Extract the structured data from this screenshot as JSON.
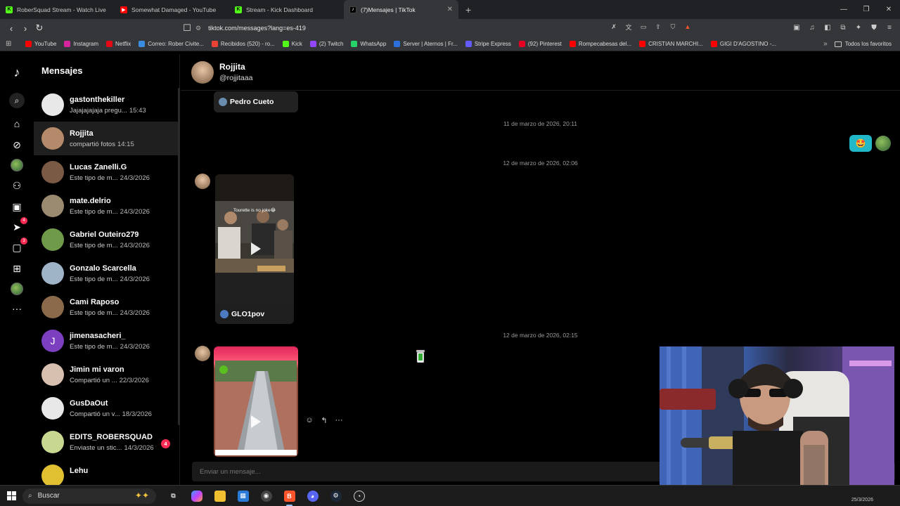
{
  "browser": {
    "tabs": [
      {
        "title": "RoberSquad Stream - Watch Live",
        "icon": "kick-icon"
      },
      {
        "title": "Somewhat Damaged - YouTube",
        "icon": "youtube-icon"
      },
      {
        "title": "Stream - Kick Dashboard",
        "icon": "kick-icon"
      },
      {
        "title": "(7)Mensajes | TikTok",
        "icon": "tiktok-icon"
      }
    ],
    "url": "tiktok.com/messages?lang=es-419",
    "bookmarks": [
      {
        "label": "YouTube",
        "color": "#ff0000"
      },
      {
        "label": "Instagram",
        "color": "#d6249f"
      },
      {
        "label": "Netflix",
        "color": "#e50914"
      },
      {
        "label": "Correo: Rober Civite...",
        "color": "#3a8de0"
      },
      {
        "label": "Recibidos (520) - ro...",
        "color": "#ea4335"
      },
      {
        "label": "Kick",
        "color": "#53fc18"
      },
      {
        "label": "(2) Twitch",
        "color": "#9146ff"
      },
      {
        "label": "WhatsApp",
        "color": "#25d366"
      },
      {
        "label": "Server | Aternos | Fr...",
        "color": "#2a6fdb"
      },
      {
        "label": "Stripe Express",
        "color": "#635bff"
      },
      {
        "label": "(92) Pinterest",
        "color": "#e60023"
      },
      {
        "label": "Rompecabesas del...",
        "color": "#ff0000"
      },
      {
        "label": "CRISTIAN MARCHI...",
        "color": "#ff0000"
      },
      {
        "label": "GIGI D'AGOSTINO -...",
        "color": "#ff0000"
      }
    ],
    "all_bookmarks": "Todos los favoritos"
  },
  "sidebar": {
    "title": "Mensajes",
    "conversations": [
      {
        "name": "gastonthekiller",
        "preview": "Jajajajajaja pregu...",
        "time": "15:43",
        "avatar_color": "#e8e8e8"
      },
      {
        "name": "Rojjita",
        "preview": "compartió fotos",
        "time": "14:15",
        "avatar_color": "#b48a6a"
      },
      {
        "name": "Lucas Zanelli.G",
        "preview": "Este tipo de m...",
        "time": "24/3/2026",
        "avatar_color": "#7a5a44"
      },
      {
        "name": "mate.delrio",
        "preview": "Este tipo de m...",
        "time": "24/3/2026",
        "avatar_color": "#9a8a70"
      },
      {
        "name": "Gabriel Outeiro279",
        "preview": "Este tipo de m...",
        "time": "24/3/2026",
        "avatar_color": "#6f9a4a"
      },
      {
        "name": "Gonzalo Scarcella",
        "preview": "Este tipo de m...",
        "time": "24/3/2026",
        "avatar_color": "#a0b4c8"
      },
      {
        "name": "Cami Raposo",
        "preview": "Este tipo de m...",
        "time": "24/3/2026",
        "avatar_color": "#8a6a4a"
      },
      {
        "name": "jimenasacheri_",
        "preview": "Este tipo de m...",
        "time": "24/3/2026",
        "avatar_color": "#7b3fc0",
        "initial": "J"
      },
      {
        "name": "Jimin mi varon",
        "preview": "Compartió un ...",
        "time": "22/3/2026",
        "avatar_color": "#d8c0b0"
      },
      {
        "name": "GusDaOut",
        "preview": "Compartió un v...",
        "time": "18/3/2026",
        "avatar_color": "#e8e8e8"
      },
      {
        "name": "EDITS_ROBERSQUAD",
        "preview": "Enviaste un stic...",
        "time": "14/3/2026",
        "avatar_color": "#c8d890",
        "unread": "4"
      },
      {
        "name": "Lehu",
        "preview": "",
        "time": "",
        "avatar_color": "#e0c030"
      }
    ]
  },
  "rail": {
    "inbox_badge": "4",
    "messages_badge": "3"
  },
  "chat": {
    "name": "Rojjita",
    "handle": "@rojjitaaa",
    "first_card_author": "Pedro Cueto",
    "timestamps": [
      "11 de marzo de 2026, 20:11",
      "12 de marzo de 2026, 02:06",
      "12 de marzo de 2026, 02:15"
    ],
    "video_caption": "Tourette is no joke😂",
    "second_card_author": "GLO1pov",
    "sent_emoji": "🤩",
    "input_placeholder": "Enviar un mensaje..."
  },
  "taskbar": {
    "search_label": "Buscar",
    "clock_date": "25/3/2026"
  },
  "colors": {
    "accent": "#fe2c55",
    "sent_bubble": "#20b8c8"
  }
}
